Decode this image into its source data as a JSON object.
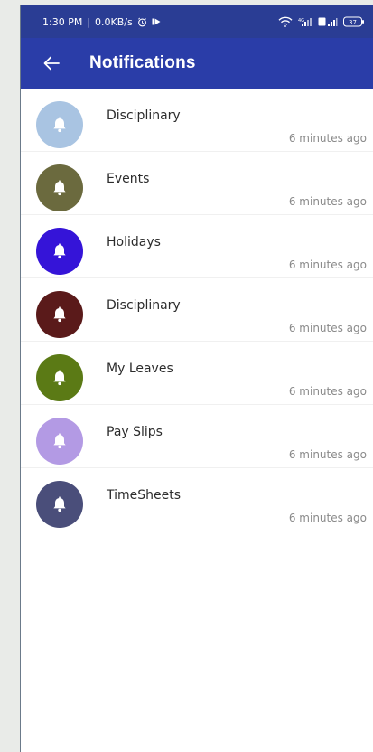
{
  "status_bar": {
    "time": "1:30 PM",
    "speed": "0.0KB/s",
    "battery": "37",
    "icons": [
      "alarm-icon",
      "play-icon",
      "wifi-icon",
      "signal-icon",
      "volte-signal-icon",
      "battery-icon"
    ]
  },
  "header": {
    "title": "Notifications",
    "back_icon": "arrow-left-icon",
    "color": "#2a3da8"
  },
  "notifications": [
    {
      "title": "Disciplinary",
      "time": "6 minutes ago",
      "color": "#a9c4e2",
      "icon": "bell-icon"
    },
    {
      "title": "Events",
      "time": "6 minutes ago",
      "color": "#6b6a3e",
      "icon": "bell-icon"
    },
    {
      "title": "Holidays",
      "time": "6 minutes ago",
      "color": "#3514d8",
      "icon": "bell-icon"
    },
    {
      "title": "Disciplinary",
      "time": "6 minutes ago",
      "color": "#5a1a1a",
      "icon": "bell-icon"
    },
    {
      "title": "My Leaves",
      "time": "6 minutes ago",
      "color": "#5b7a15",
      "icon": "bell-icon"
    },
    {
      "title": "Pay Slips",
      "time": "6 minutes ago",
      "color": "#b39ae4",
      "icon": "bell-icon"
    },
    {
      "title": "TimeSheets",
      "time": "6 minutes ago",
      "color": "#4a4e7a",
      "icon": "bell-icon"
    }
  ]
}
